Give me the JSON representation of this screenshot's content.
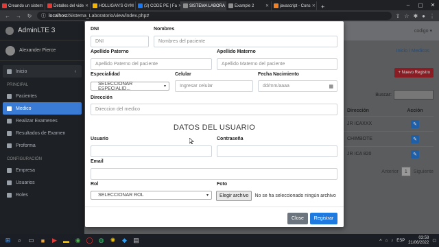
{
  "browser": {
    "tabs": [
      {
        "title": "Creando un sistem",
        "color": "#e53935"
      },
      {
        "title": "Detalles del vide",
        "color": "#e53935"
      },
      {
        "title": "HOLLIGAN'S GYM",
        "color": "#f5b400"
      },
      {
        "title": "(3) CODE PE | Fa",
        "color": "#1877f2"
      },
      {
        "title": "SISTEMA LABORA",
        "color": "#8e8e8e",
        "active": true
      },
      {
        "title": "Example 2",
        "color": "#8e8e8e"
      },
      {
        "title": "javascript - Cons",
        "color": "#f48024"
      }
    ],
    "new_tab": "+",
    "url_host": "localhost",
    "url_path": "/Sistema_Laboratorio/view/index.php#"
  },
  "sidebar": {
    "brand": "AdminLTE 3",
    "user": "Alexander Pierce",
    "menu_inicio": "Inicio",
    "header_principal": "PRINCIPAL",
    "items_principal": [
      "Pacientes",
      "Medico",
      "Realizar Examenes",
      "Resultados de Examen",
      "Proforma"
    ],
    "header_config": "CONFIGURACIÓN",
    "items_config": [
      "Empresa",
      "Usuarios",
      "Roles"
    ]
  },
  "background": {
    "user_menu": "codigo ▾",
    "breadcrumb": "Inicio / Medicos",
    "new_button": "+ Nuevo Registro",
    "search_label": "Buscar:",
    "col_direccion": "Dirección",
    "col_accion": "Acción",
    "rows": [
      "JR ICAXXX",
      "CHIMBOTE",
      "JR ICA 820"
    ],
    "pager_prev": "Anterior",
    "pager_page": "1",
    "pager_next": "Siguiente"
  },
  "modal": {
    "dni_label": "DNI",
    "dni_placeholder": "DNI",
    "nombres_label": "Nombres",
    "nombres_placeholder": "Nombres del paciente",
    "ap_paterno_label": "Apellido Paterno",
    "ap_paterno_placeholder": "Apellido Paterno del paciente",
    "ap_materno_label": "Apellido Materno",
    "ap_materno_placeholder": "Apellido Materno del paciente",
    "especialidad_label": "Especialidad",
    "especialidad_value": "SELECCIONAR ESPECIALID...",
    "celular_label": "Celular",
    "celular_placeholder": "Ingresar celular",
    "fecha_label": "Fecha Nacimiento",
    "fecha_placeholder": "dd/mm/aaaa",
    "direccion_label": "Dirección",
    "direccion_placeholder": "Direccion del medico",
    "section_title": "DATOS DEL USUARIO",
    "usuario_label": "Usuario",
    "contrasena_label": "Contraseña",
    "email_label": "Email",
    "rol_label": "Rol",
    "rol_value": "SELECCIONAR ROL",
    "foto_label": "Foto",
    "file_button": "Elegir archivo",
    "file_status": "No se ha seleccionado ningún archivo",
    "close_button": "Close",
    "register_button": "Registrar"
  },
  "taskbar": {
    "lang": "ESP",
    "time": "03:58",
    "date": "21/06/2022"
  }
}
